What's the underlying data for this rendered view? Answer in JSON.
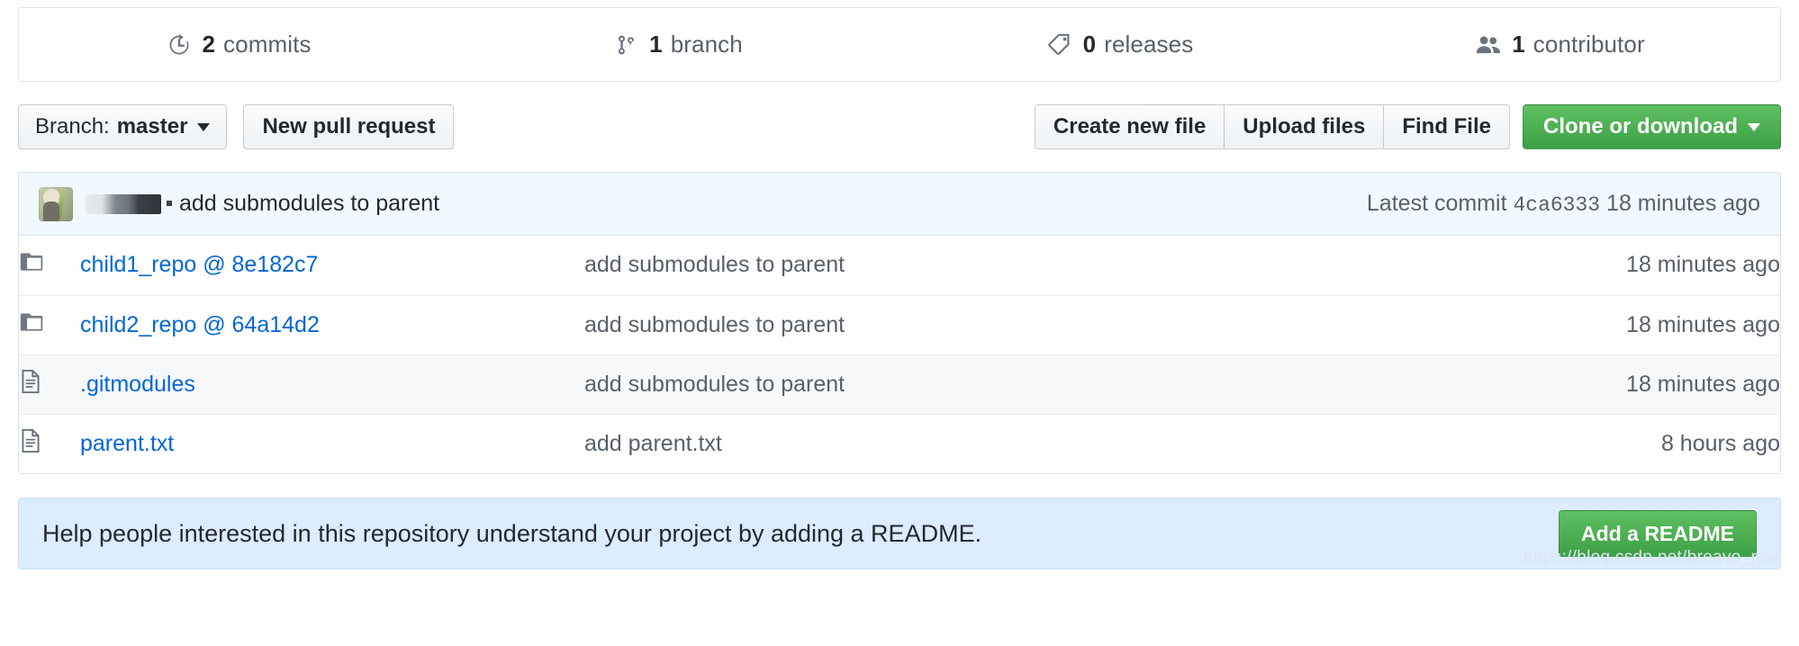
{
  "summary": {
    "items": [
      {
        "icon": "history-icon",
        "count": "2",
        "label": "commits"
      },
      {
        "icon": "git-branch-icon",
        "count": "1",
        "label": "branch"
      },
      {
        "icon": "tag-icon",
        "count": "0",
        "label": "releases"
      },
      {
        "icon": "people-icon",
        "count": "1",
        "label": "contributor"
      }
    ]
  },
  "toolbar": {
    "branch_label": "Branch:",
    "branch_value": "master",
    "new_pull_request": "New pull request",
    "create_new_file": "Create new file",
    "upload_files": "Upload files",
    "find_file": "Find File",
    "clone_or_download": "Clone or download"
  },
  "latest_commit": {
    "author": "",
    "message": "add submodules to parent",
    "prefix": "Latest commit",
    "sha": "4ca6333",
    "age": "18 minutes ago"
  },
  "files": {
    "rows": [
      {
        "icon": "submodule-icon",
        "name": "child1_repo @ 8e182c7",
        "message": "add submodules to parent",
        "age": "18 minutes ago"
      },
      {
        "icon": "submodule-icon",
        "name": "child2_repo @ 64a14d2",
        "message": "add submodules to parent",
        "age": "18 minutes ago"
      },
      {
        "icon": "file-icon",
        "name": ".gitmodules",
        "message": "add submodules to parent",
        "age": "18 minutes ago"
      },
      {
        "icon": "file-icon",
        "name": "parent.txt",
        "message": "add parent.txt",
        "age": "8 hours ago"
      }
    ]
  },
  "readme_banner": {
    "text": "Help people interested in this repository understand your project by adding a README.",
    "button": "Add a README"
  },
  "watermark": "https://blog.csdn.net/breavo_raw",
  "colors": {
    "link": "#0366d6",
    "green_button": "#41a347",
    "banner_bg": "#dbedff",
    "commit_tease_bg": "#f1f8ff"
  }
}
